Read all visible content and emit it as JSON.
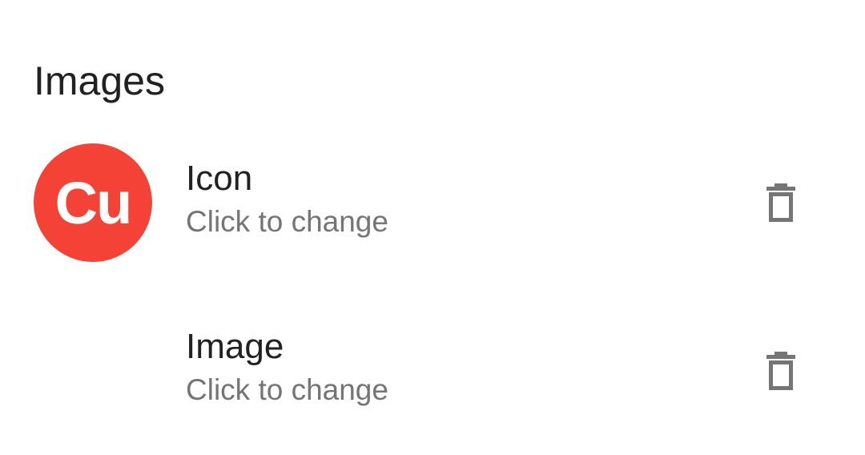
{
  "section": {
    "title": "Images"
  },
  "rows": [
    {
      "avatar_text": "Cu",
      "avatar_color": "#f44336",
      "title": "Icon",
      "subtitle": "Click to change",
      "action_icon": "trash-icon"
    },
    {
      "title": "Image",
      "subtitle": "Click to change",
      "action_icon": "trash-icon"
    }
  ],
  "colors": {
    "title_text": "#212121",
    "subtitle_text": "#757575",
    "icon": "#757575"
  }
}
